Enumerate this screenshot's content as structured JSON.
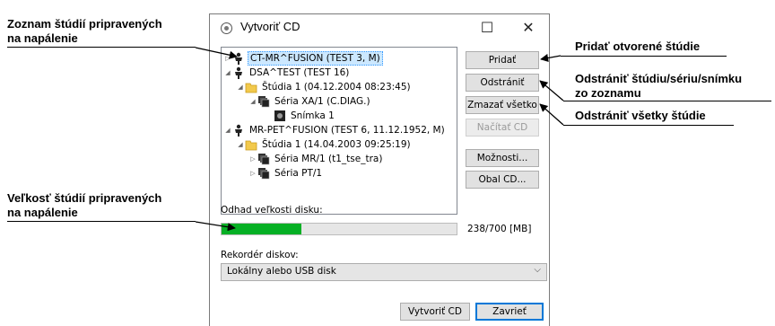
{
  "window": {
    "title": "Vytvoriť CD",
    "minimize": "☐",
    "close": "✕"
  },
  "tree": [
    {
      "label": "CT-MR^FUSION (TEST 3, M)",
      "toggle": "▷",
      "icon": "person-icon",
      "selected": true
    },
    {
      "label": "DSA^TEST (TEST 16)",
      "toggle": "◢",
      "icon": "person-icon"
    },
    {
      "label": "Štúdia 1 (04.12.2004 08:23:45)",
      "toggle": "◢",
      "icon": "folder-icon"
    },
    {
      "label": "Séria XA/1 (C.DIAG.)",
      "toggle": "◢",
      "icon": "series-icon"
    },
    {
      "label": "Snímka 1",
      "toggle": "",
      "icon": "image-icon"
    },
    {
      "label": "MR-PET^FUSION (TEST 6, 11.12.1952, M)",
      "toggle": "◢",
      "icon": "person-icon"
    },
    {
      "label": "Štúdia 1 (14.04.2003 09:25:19)",
      "toggle": "◢",
      "icon": "folder-icon"
    },
    {
      "label": "Séria MR/1 (t1_tse_tra)",
      "toggle": "▷",
      "icon": "series-icon"
    },
    {
      "label": "Séria PT/1",
      "toggle": "▷",
      "icon": "series-icon"
    }
  ],
  "buttons": {
    "add": "Pridať",
    "remove": "Odstrániť",
    "delete_all": "Zmazať všetko",
    "load_cd": "Načítať CD",
    "options": "Možnosti...",
    "cd_cover": "Obal CD...",
    "create_cd": "Vytvoriť CD",
    "close": "Zavrieť"
  },
  "disk": {
    "label": "Odhad veľkosti disku:",
    "used": 238,
    "capacity": 700,
    "size_text": "238/700 [MB]",
    "fraction": 0.34
  },
  "recorder": {
    "label": "Rekordér diskov:",
    "value": "Lokálny alebo USB disk"
  },
  "callouts": {
    "list_line1": "Zoznam štúdií pripravených",
    "list_line2": "na napálenie",
    "size_line1": "Veľkosť štúdií pripravených",
    "size_line2": "na napálenie",
    "add": "Pridať otvorené štúdie",
    "remove_line1": "Odstrániť štúdiu/sériu/snímku",
    "remove_line2": "zo zoznamu",
    "delete_all": "Odstrániť všetky štúdie"
  },
  "colors": {
    "progress_fill": "#06b025",
    "selection": "#cce8ff",
    "focus_border": "#0078d7"
  }
}
